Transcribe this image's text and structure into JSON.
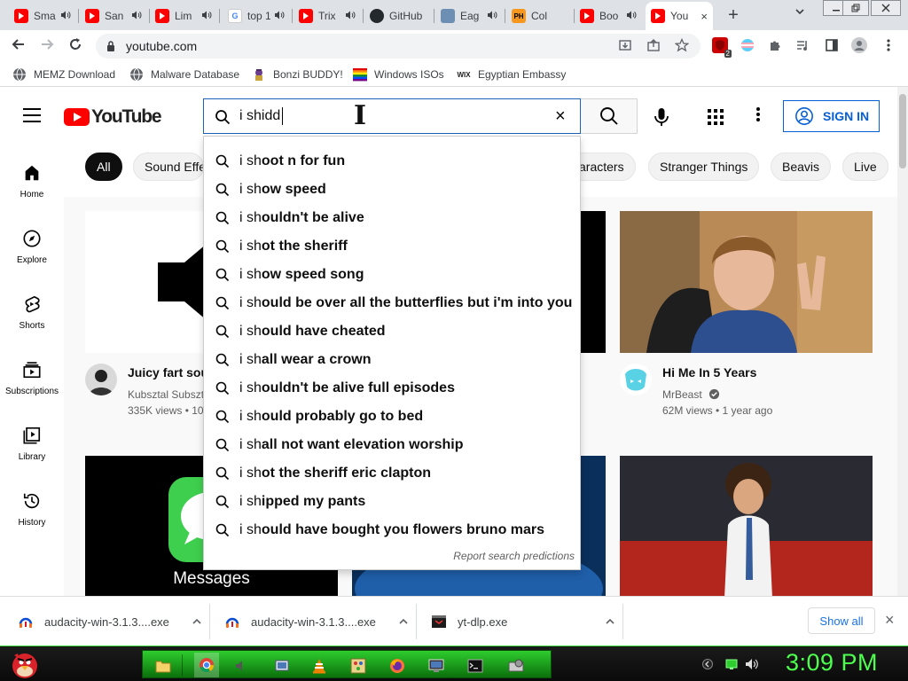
{
  "browser": {
    "tabs": [
      {
        "title": "Sma",
        "favicon": "youtube-icon",
        "audio": true
      },
      {
        "title": "San",
        "favicon": "youtube-icon",
        "audio": true
      },
      {
        "title": "Lim",
        "favicon": "youtube-icon",
        "audio": true
      },
      {
        "title": "top 10",
        "favicon": "google-icon",
        "audio": true
      },
      {
        "title": "Trix",
        "favicon": "youtube-icon",
        "audio": true
      },
      {
        "title": "GitHub",
        "favicon": "github-icon",
        "audio": false
      },
      {
        "title": "Eag",
        "favicon": "generic-site-icon",
        "audio": true
      },
      {
        "title": "Col",
        "favicon": "ph-icon",
        "audio": false
      },
      {
        "title": "Boo",
        "favicon": "youtube-icon",
        "audio": true
      },
      {
        "title": "You",
        "favicon": "youtube-icon",
        "audio": false,
        "active": true
      }
    ],
    "active_tab_close": "×",
    "new_tab": "+",
    "url": "youtube.com",
    "bookmarks": [
      {
        "label": "MEMZ Download",
        "icon": "globe-icon"
      },
      {
        "label": "Malware Database",
        "icon": "globe-icon"
      },
      {
        "label": "Bonzi BUDDY!",
        "icon": "bonzi-icon"
      },
      {
        "label": "Windows ISOs",
        "icon": "windows-icon"
      },
      {
        "label": "Egyptian Embassy",
        "icon": "wix-icon"
      }
    ],
    "ext_badge": "2",
    "wix_label": "WIX",
    "ph_label": "PH"
  },
  "youtube": {
    "logo_text": "YouTube",
    "search_value": "i shidd",
    "search_clear": "×",
    "sign_in": "SIGN IN",
    "chips": [
      "All",
      "Sound Effe",
      "aracters",
      "Stranger Things",
      "Beavis",
      "Live"
    ],
    "guide": [
      {
        "label": "Home",
        "icon": "home-icon"
      },
      {
        "label": "Explore",
        "icon": "compass-icon"
      },
      {
        "label": "Shorts",
        "icon": "shorts-icon"
      },
      {
        "label": "Subscriptions",
        "icon": "subscriptions-icon"
      },
      {
        "label": "Library",
        "icon": "library-icon"
      },
      {
        "label": "History",
        "icon": "history-icon"
      }
    ],
    "suggestions": [
      {
        "bold": "i sh",
        "rest": "oot n for fun"
      },
      {
        "bold": "i sh",
        "rest": "ow speed"
      },
      {
        "bold": "i sh",
        "rest": "ouldn't be alive"
      },
      {
        "bold": "i sh",
        "rest": "ot the sheriff"
      },
      {
        "bold": "i sh",
        "rest": "ow speed song"
      },
      {
        "bold": "i sh",
        "rest": "ould be over all the butterflies but i'm into you"
      },
      {
        "bold": "i sh",
        "rest": "ould have cheated"
      },
      {
        "bold": "i sh",
        "rest": "all wear a crown"
      },
      {
        "bold": "i sh",
        "rest": "ouldn't be alive full episodes"
      },
      {
        "bold": "i sh",
        "rest": "ould probably go to bed"
      },
      {
        "bold": "i sh",
        "rest": "all not want elevation worship"
      },
      {
        "bold": "i sh",
        "rest": "ot the sheriff eric clapton"
      },
      {
        "bold": "i sh",
        "rest": "ipped my pants"
      },
      {
        "bold": "i sh",
        "rest": "ould have bought you flowers bruno mars"
      }
    ],
    "report_link": "Report search predictions",
    "videos": [
      {
        "title": "Juicy fart sou",
        "channel": "Kubsztal Subszt",
        "meta": "335K views • 10"
      },
      {
        "title": "Hi Me In 5 Years",
        "channel": "MrBeast",
        "meta": "62M views • 1 year ago",
        "verified": true
      }
    ],
    "messages_label": "Messages"
  },
  "downloads": {
    "items": [
      {
        "name": "audacity-win-3.1.3....exe",
        "icon": "audacity-icon"
      },
      {
        "name": "audacity-win-3.1.3....exe",
        "icon": "audacity-icon"
      },
      {
        "name": "yt-dlp.exe",
        "icon": "exe-icon"
      }
    ],
    "show_all": "Show all",
    "close": "×"
  },
  "taskbar": {
    "clock": "3:09 PM"
  },
  "colors": {
    "youtube_red": "#ff0000",
    "link_blue": "#065fd4",
    "taskbar_green": "#2ecc2e",
    "clock_green": "#4dff4d"
  }
}
